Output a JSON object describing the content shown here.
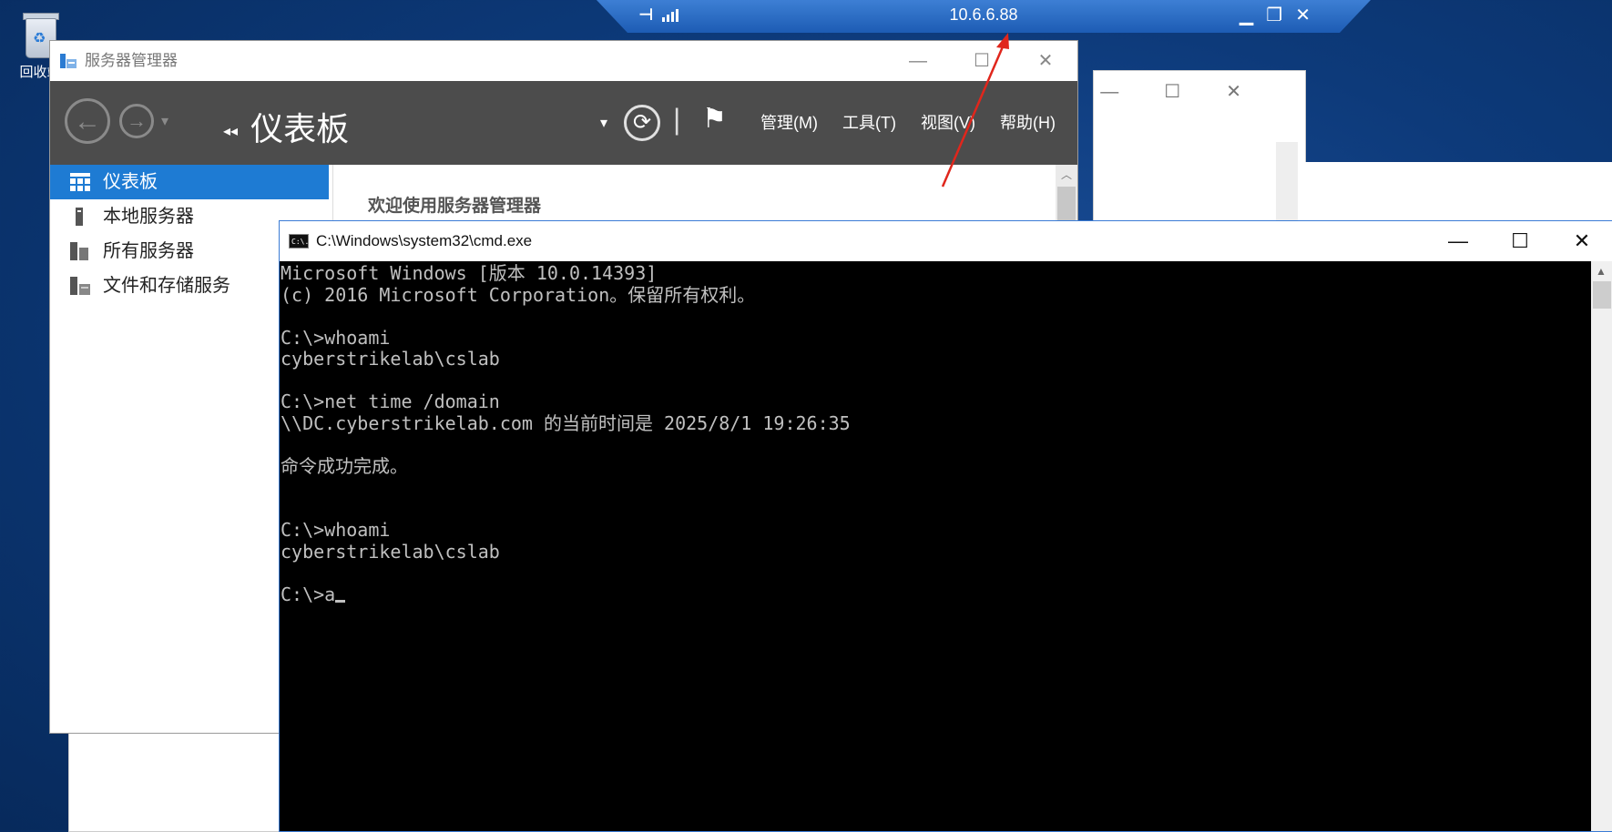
{
  "desktop": {
    "recycle_bin_label": "回收站"
  },
  "rdp_bar": {
    "host": "10.6.6.88",
    "pin_glyph": "⊢",
    "controls": [
      "▁",
      "❐",
      "✕"
    ]
  },
  "bg_window": {
    "controls": [
      "—",
      "☐",
      "✕"
    ]
  },
  "server_manager": {
    "title": "服务器管理器",
    "controls": [
      "—",
      "☐",
      "✕"
    ],
    "breadcrumb_arrows": "◂◂",
    "breadcrumb": "仪表板",
    "menus": [
      "管理(M)",
      "工具(T)",
      "视图(V)",
      "帮助(H)"
    ],
    "nav": [
      {
        "label": "仪表板",
        "icon": "dashboard-icon",
        "active": true
      },
      {
        "label": "本地服务器",
        "icon": "server-icon",
        "active": false
      },
      {
        "label": "所有服务器",
        "icon": "servers-icon",
        "active": false
      },
      {
        "label": "文件和存储服务",
        "icon": "storage-icon",
        "active": false
      }
    ],
    "welcome": "欢迎使用服务器管理器",
    "accent": "#1e7bd3",
    "toolbar_bg": "#4c4c4c"
  },
  "cmd": {
    "title": "C:\\Windows\\system32\\cmd.exe",
    "icon_text": "C:\\.",
    "controls": [
      "—",
      "☐",
      "✕"
    ],
    "lines": [
      "Microsoft Windows [版本 10.0.14393]",
      "(c) 2016 Microsoft Corporation。保留所有权利。",
      "",
      "C:\\>whoami",
      "cyberstrikelab\\cslab",
      "",
      "C:\\>net time /domain",
      "\\\\DC.cyberstrikelab.com 的当前时间是 2025/8/1 19:26:35",
      "",
      "命令成功完成。",
      "",
      "",
      "C:\\>whoami",
      "cyberstrikelab\\cslab",
      "",
      "C:\\>a"
    ]
  },
  "annotation": {
    "color": "#e0261c"
  }
}
